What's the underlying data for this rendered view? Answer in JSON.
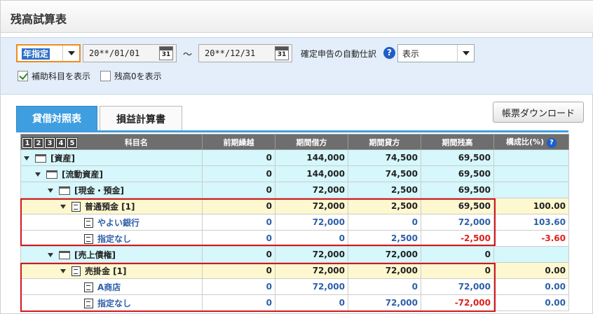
{
  "page": {
    "title": "残高試算表"
  },
  "filter": {
    "period_value": "年指定",
    "date_from": "20**/01/01",
    "date_to": "20**/12/31",
    "calendar_label": "31",
    "tilde": "～",
    "auto_label": "確定申告の自動仕訳",
    "help": "?",
    "auto_value": "表示",
    "show_sub": "補助科目を表示",
    "show_zero": "残高0を表示"
  },
  "tabs": {
    "balance": "貸借対照表",
    "income": "損益計算書"
  },
  "download": "帳票ダウンロード",
  "table": {
    "levels": [
      "1",
      "2",
      "3",
      "4",
      "5"
    ],
    "headers": [
      "科目名",
      "前期繰越",
      "期間借方",
      "期間貸方",
      "期間残高",
      "構成比(%)"
    ],
    "rows": [
      {
        "name": "[資産]",
        "c1": "0",
        "c2": "144,000",
        "c3": "74,500",
        "c4": "69,500",
        "c5": ""
      },
      {
        "name": "[流動資産]",
        "c1": "0",
        "c2": "144,000",
        "c3": "74,500",
        "c4": "69,500",
        "c5": ""
      },
      {
        "name": "[現金・預金]",
        "c1": "0",
        "c2": "72,000",
        "c3": "2,500",
        "c4": "69,500",
        "c5": ""
      },
      {
        "name": "普通預金 [1]",
        "c1": "0",
        "c2": "72,000",
        "c3": "2,500",
        "c4": "69,500",
        "c5": "100.00"
      },
      {
        "name": "やよい銀行",
        "c1": "0",
        "c2": "72,000",
        "c3": "0",
        "c4": "72,000",
        "c5": "103.60"
      },
      {
        "name": "指定なし",
        "c1": "0",
        "c2": "0",
        "c3": "2,500",
        "c4": "-2,500",
        "c5": "-3.60"
      },
      {
        "name": "[売上債権]",
        "c1": "0",
        "c2": "72,000",
        "c3": "72,000",
        "c4": "0",
        "c5": ""
      },
      {
        "name": "売掛金 [1]",
        "c1": "0",
        "c2": "72,000",
        "c3": "72,000",
        "c4": "0",
        "c5": "0.00"
      },
      {
        "name": "A商店",
        "c1": "0",
        "c2": "72,000",
        "c3": "0",
        "c4": "72,000",
        "c5": "0.00"
      },
      {
        "name": "指定なし",
        "c1": "0",
        "c2": "0",
        "c3": "72,000",
        "c4": "-72,000",
        "c5": "0.00"
      }
    ]
  }
}
